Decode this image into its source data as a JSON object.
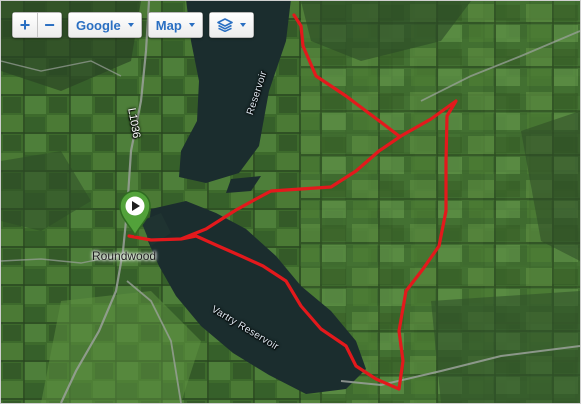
{
  "controls": {
    "zoom_in_label": "+",
    "zoom_out_label": "−",
    "provider_label": "Google",
    "maptype_label": "Map",
    "layers_icon": "layers-icon"
  },
  "labels": {
    "road": "L1036",
    "reservoir_north": "Reservoir",
    "reservoir_south": "Vartry Reservoir",
    "town": "Roundwood"
  },
  "marker": {
    "icon": "play-icon",
    "color": "#52a23a"
  },
  "route": {
    "color": "#e3191c"
  },
  "colors": {
    "water": "#1b2d2e",
    "fields": "#3f6a2e",
    "control_text": "#2a6fc2"
  }
}
